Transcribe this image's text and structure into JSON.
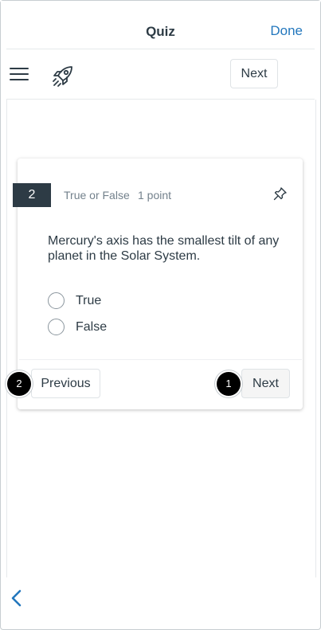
{
  "navbar": {
    "title": "Quiz",
    "done_label": "Done"
  },
  "toolbar": {
    "next_label": "Next"
  },
  "question": {
    "number": "2",
    "type": "True or False",
    "points": "1 point",
    "text": "Mercury's axis has the smallest tilt of any planet in the Solar System.",
    "options": [
      {
        "label": "True"
      },
      {
        "label": "False"
      }
    ]
  },
  "footer": {
    "previous_label": "Previous",
    "next_label": "Next"
  },
  "markers": {
    "previous": "2",
    "next": "1"
  },
  "icons": {
    "menu": "hamburger-menu-icon",
    "rocket": "rocket-icon",
    "pin": "pin-icon",
    "back": "chevron-left-icon"
  },
  "colors": {
    "accent": "#2377bd",
    "question_badge": "#2d3b45",
    "text": "#2d3b45",
    "muted": "#73818c"
  }
}
